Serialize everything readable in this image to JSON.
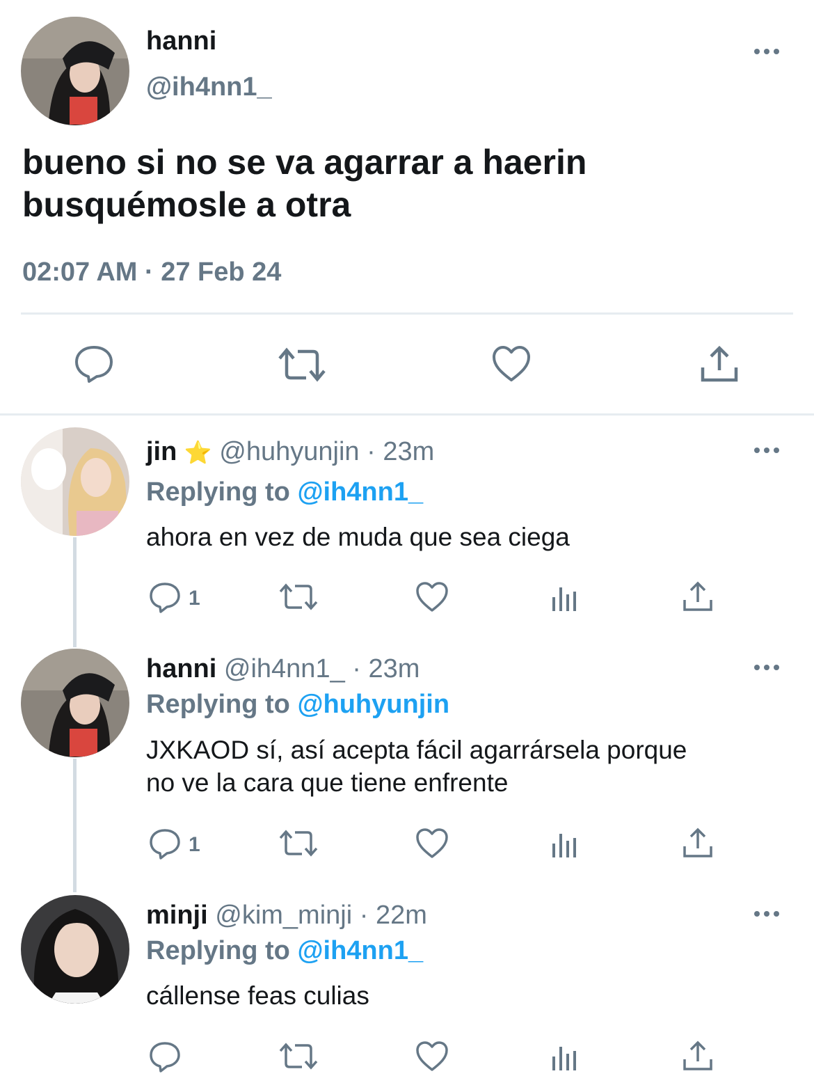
{
  "main_tweet": {
    "display_name": "hanni",
    "handle": "@ih4nn1_",
    "text_line1": "bueno si no se va agarrar a haerin",
    "text_line2": "busquémosle a otra",
    "timestamp": "02:07 AM · 27 Feb 24"
  },
  "replies": [
    {
      "display_name": "jin",
      "badge": "⭐",
      "meta": "@huhyunjin · 23m",
      "replying_prefix": "Replying to ",
      "replying_to": "@ih4nn1_",
      "text_line1": "ahora en vez de muda que sea ciega",
      "text_line2": "",
      "reply_count": "1"
    },
    {
      "display_name": "hanni",
      "meta": "@ih4nn1_ · 23m",
      "replying_prefix": "Replying to ",
      "replying_to": "@huhyunjin",
      "text_line1": "JXKAOD sí, así acepta fácil agarrársela porque",
      "text_line2": "no ve la cara que tiene enfrente",
      "reply_count": "1"
    },
    {
      "display_name": "minji",
      "meta": "@kim_minji · 22m",
      "replying_prefix": "Replying to ",
      "replying_to": "@ih4nn1_",
      "text_line1": "cállense feas culias",
      "text_line2": "",
      "reply_count": ""
    }
  ],
  "icons": [
    "reply-icon",
    "retweet-icon",
    "like-icon",
    "views-icon",
    "share-icon",
    "more-icon"
  ],
  "colors": {
    "text": "#14171a",
    "secondary": "#657786",
    "link": "#1da1f2",
    "divider": "#e6ecf0",
    "thread_line": "#d3dbe2"
  }
}
